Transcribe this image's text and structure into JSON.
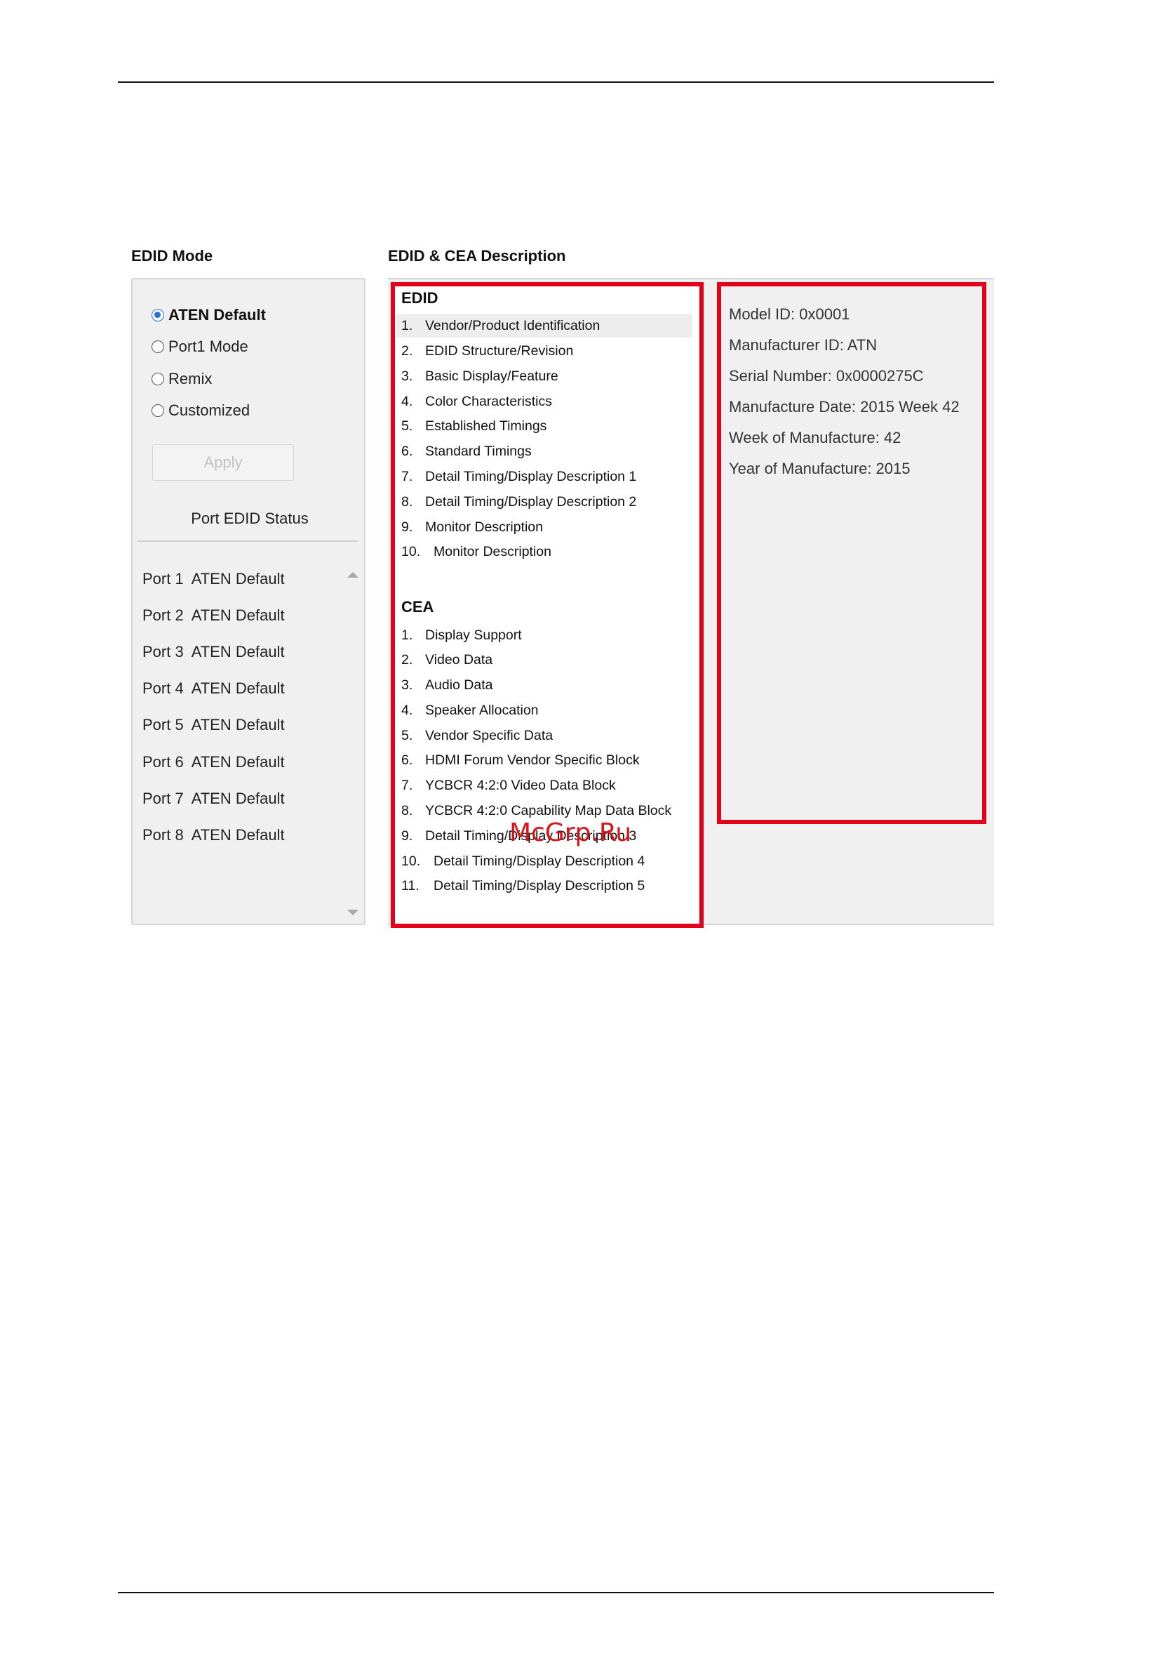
{
  "edid_mode": {
    "title": "EDID Mode",
    "options": [
      {
        "label": "ATEN Default",
        "selected": true
      },
      {
        "label": "Port1 Mode",
        "selected": false
      },
      {
        "label": "Remix",
        "selected": false
      },
      {
        "label": "Customized",
        "selected": false
      }
    ],
    "apply_label": "Apply",
    "status_title": "Port EDID Status",
    "ports": [
      "Port 1  ATEN Default",
      "Port 2  ATEN Default",
      "Port 3  ATEN Default",
      "Port 4  ATEN Default",
      "Port 5  ATEN Default",
      "Port 6  ATEN Default",
      "Port 7  ATEN Default",
      "Port 8  ATEN Default"
    ]
  },
  "description": {
    "title": "EDID & CEA Description",
    "edid_title": "EDID",
    "edid_items": [
      {
        "num": "1.",
        "label": "Vendor/Product Identification"
      },
      {
        "num": "2.",
        "label": "EDID Structure/Revision"
      },
      {
        "num": "3.",
        "label": "Basic Display/Feature"
      },
      {
        "num": "4.",
        "label": "Color Characteristics"
      },
      {
        "num": "5.",
        "label": "Established Timings"
      },
      {
        "num": "6.",
        "label": "Standard Timings"
      },
      {
        "num": "7.",
        "label": "Detail Timing/Display Description 1"
      },
      {
        "num": "8.",
        "label": "Detail Timing/Display Description 2"
      },
      {
        "num": "9.",
        "label": "Monitor Description"
      },
      {
        "num": "10.",
        "label": "Monitor Description"
      }
    ],
    "cea_title": "CEA",
    "cea_items": [
      {
        "num": "1.",
        "label": "Display Support"
      },
      {
        "num": "2.",
        "label": "Video Data"
      },
      {
        "num": "3.",
        "label": "Audio Data"
      },
      {
        "num": "4.",
        "label": "Speaker Allocation"
      },
      {
        "num": "5.",
        "label": "Vendor Specific Data"
      },
      {
        "num": "6.",
        "label": "HDMI Forum Vendor Specific Block"
      },
      {
        "num": "7.",
        "label": "YCBCR 4:2:0 Video Data Block"
      },
      {
        "num": "8.",
        "label": "YCBCR 4:2:0 Capability Map Data Block"
      },
      {
        "num": "9.",
        "label": "Detail Timing/Display Description 3"
      },
      {
        "num": "10.",
        "label": "Detail Timing/Display Description 4"
      },
      {
        "num": "11.",
        "label": "Detail Timing/Display Description 5"
      }
    ],
    "info_lines": [
      "Model ID: 0x0001",
      "Manufacturer ID: ATN",
      "Serial Number: 0x0000275C",
      "Manufacture Date: 2015 Week 42",
      "Week of Manufacture: 42",
      "Year of Manufacture: 2015"
    ]
  },
  "watermark": "McGrp.Ru",
  "colors": {
    "highlight_border": "#e3001b",
    "panel_bg": "#f0f0f0",
    "radio_accent": "#2a6fd6"
  }
}
